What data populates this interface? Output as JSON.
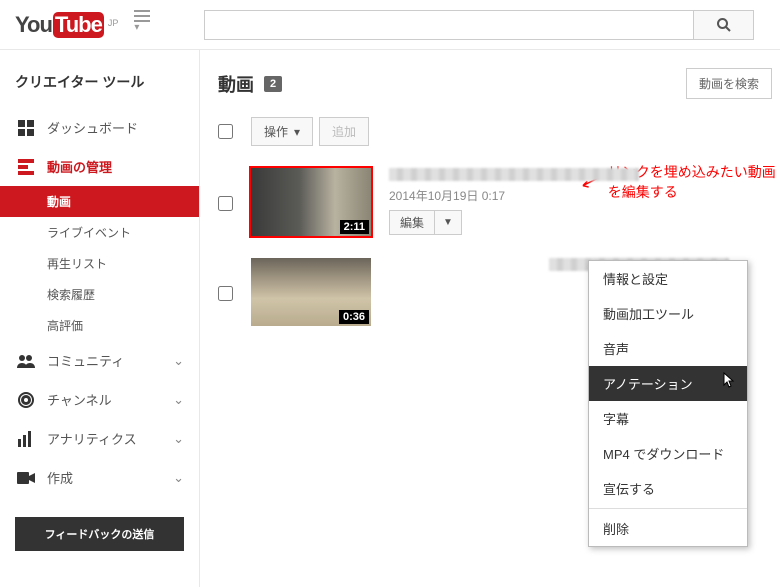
{
  "header": {
    "logo_you": "You",
    "logo_tube": "Tube",
    "locale": "JP",
    "search_placeholder": ""
  },
  "sidebar": {
    "title": "クリエイター ツール",
    "items": [
      {
        "label": "ダッシュボード",
        "icon": "dashboard"
      },
      {
        "label": "動画の管理",
        "icon": "video-manager",
        "active": true,
        "sub": [
          {
            "label": "動画",
            "selected": true
          },
          {
            "label": "ライブイベント"
          },
          {
            "label": "再生リスト"
          },
          {
            "label": "検索履歴"
          },
          {
            "label": "高評価"
          }
        ]
      },
      {
        "label": "コミュニティ",
        "icon": "community"
      },
      {
        "label": "チャンネル",
        "icon": "channel"
      },
      {
        "label": "アナリティクス",
        "icon": "analytics"
      },
      {
        "label": "作成",
        "icon": "create"
      }
    ],
    "feedback": "フィードバックの送信"
  },
  "content": {
    "title": "動画",
    "count": "2",
    "search_videos": "動画を検索",
    "toolbar": {
      "action": "操作",
      "add": "追加"
    },
    "annotation_text": "リンクを埋め込みたい動画を編集する",
    "videos": [
      {
        "duration": "2:11",
        "date": "2014年10月19日  0:17",
        "edit_label": "編集"
      },
      {
        "duration": "0:36"
      }
    ],
    "dropdown": [
      "情報と設定",
      "動画加工ツール",
      "音声",
      "アノテーション",
      "字幕",
      "MP4 でダウンロード",
      "宣伝する",
      "削除"
    ],
    "dropdown_hover_index": 3
  }
}
